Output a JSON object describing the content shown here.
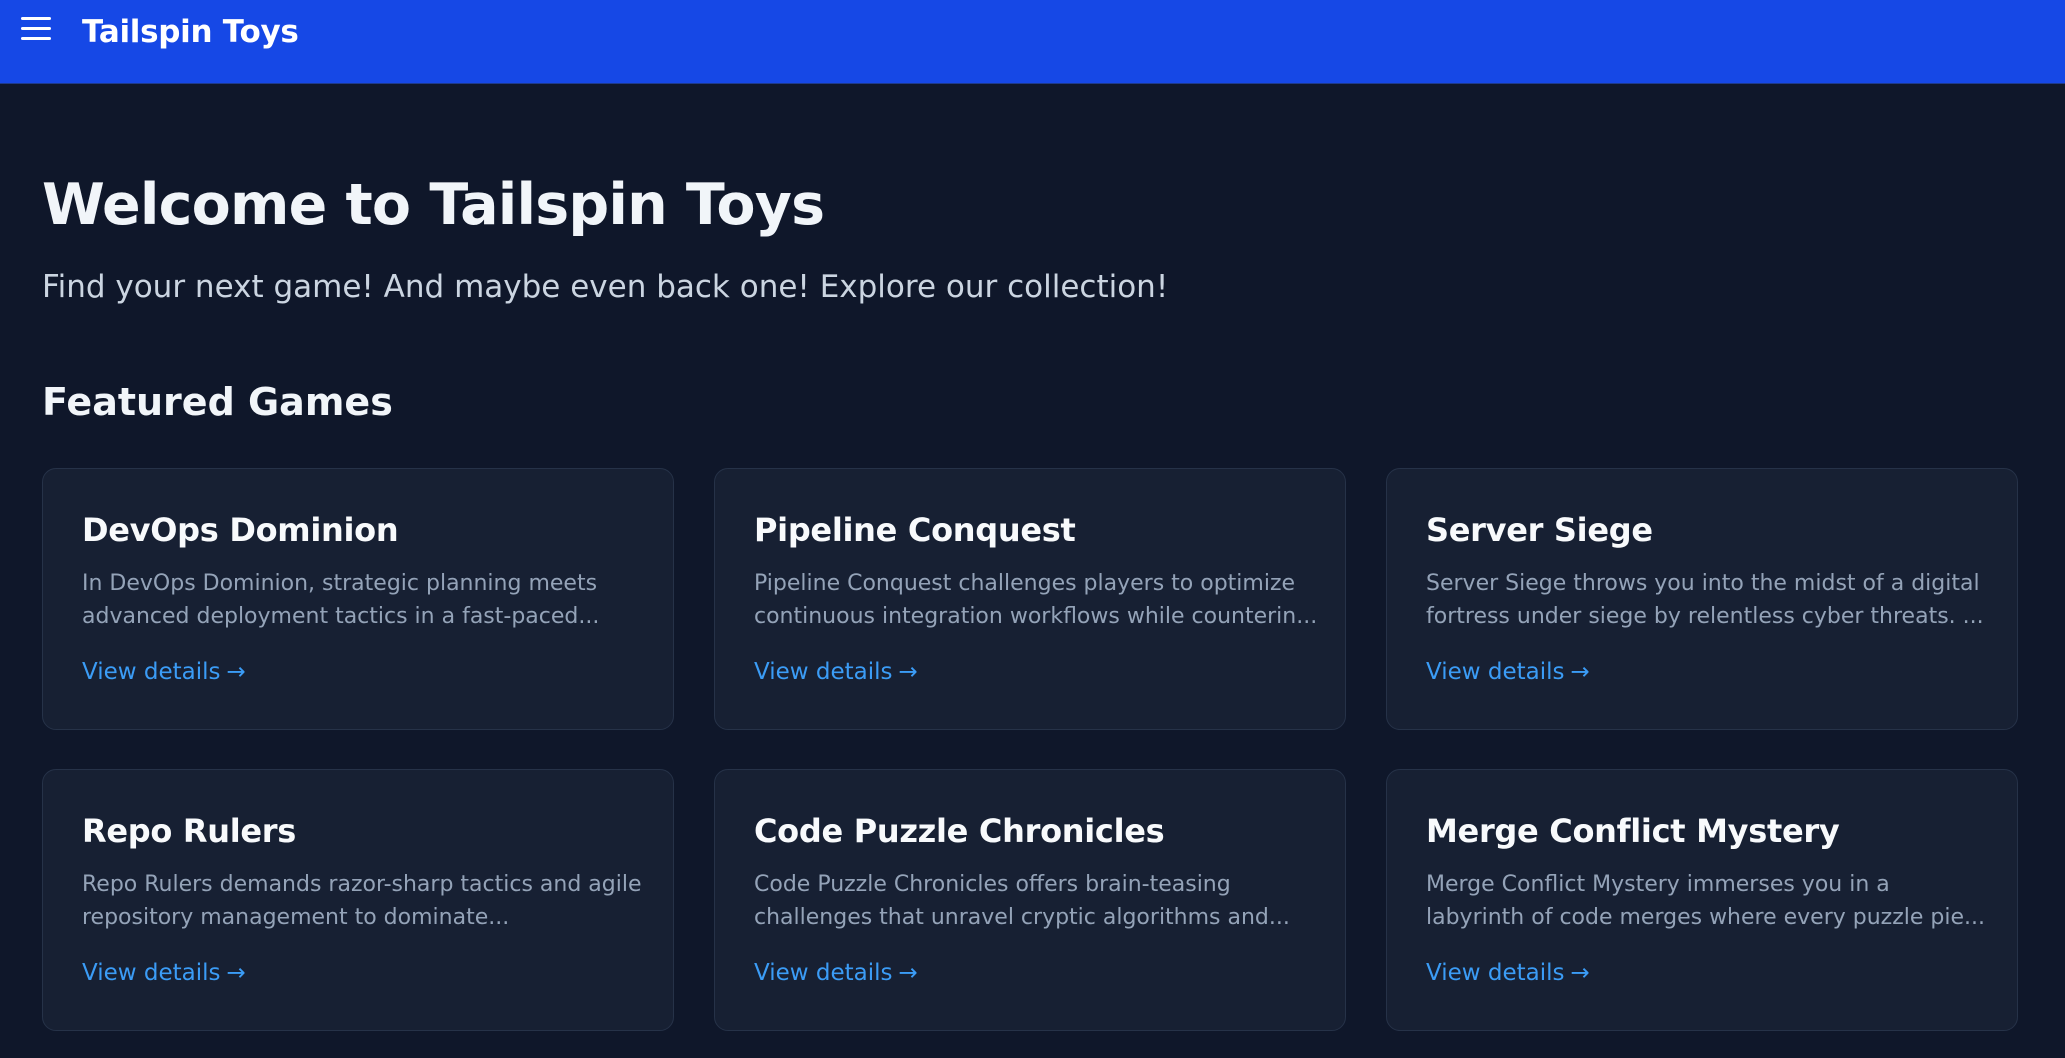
{
  "header": {
    "brand": "Tailspin Toys"
  },
  "hero": {
    "title": "Welcome to Tailspin Toys",
    "subtitle": "Find your next game! And maybe even back one! Explore our collection!"
  },
  "featured": {
    "title": "Featured Games",
    "link_label": "View details",
    "link_arrow": "→",
    "games": [
      {
        "title": "DevOps Dominion",
        "desc_line1": "In DevOps Dominion, strategic planning meets",
        "desc_line2": "advanced deployment tactics in a fast-paced..."
      },
      {
        "title": "Pipeline Conquest",
        "desc_line1": "Pipeline Conquest challenges players to optimize",
        "desc_line2": "continuous integration workflows while counterin..."
      },
      {
        "title": "Server Siege",
        "desc_line1": "Server Siege throws you into the midst of a digital",
        "desc_line2": "fortress under siege by relentless cyber threats. ..."
      },
      {
        "title": "Repo Rulers",
        "desc_line1": "Repo Rulers demands razor-sharp tactics and agile",
        "desc_line2": "repository management to dominate..."
      },
      {
        "title": "Code Puzzle Chronicles",
        "desc_line1": "Code Puzzle Chronicles offers brain-teasing",
        "desc_line2": "challenges that unravel cryptic algorithms and..."
      },
      {
        "title": "Merge Conflict Mystery",
        "desc_line1": "Merge Conflict Mystery immerses you in a",
        "desc_line2": "labyrinth of code merges where every puzzle pie..."
      }
    ]
  },
  "colors": {
    "header_bg": "#1648e6",
    "page_bg": "#0f172a",
    "card_bg": "#172033",
    "link": "#3b9cf6"
  }
}
